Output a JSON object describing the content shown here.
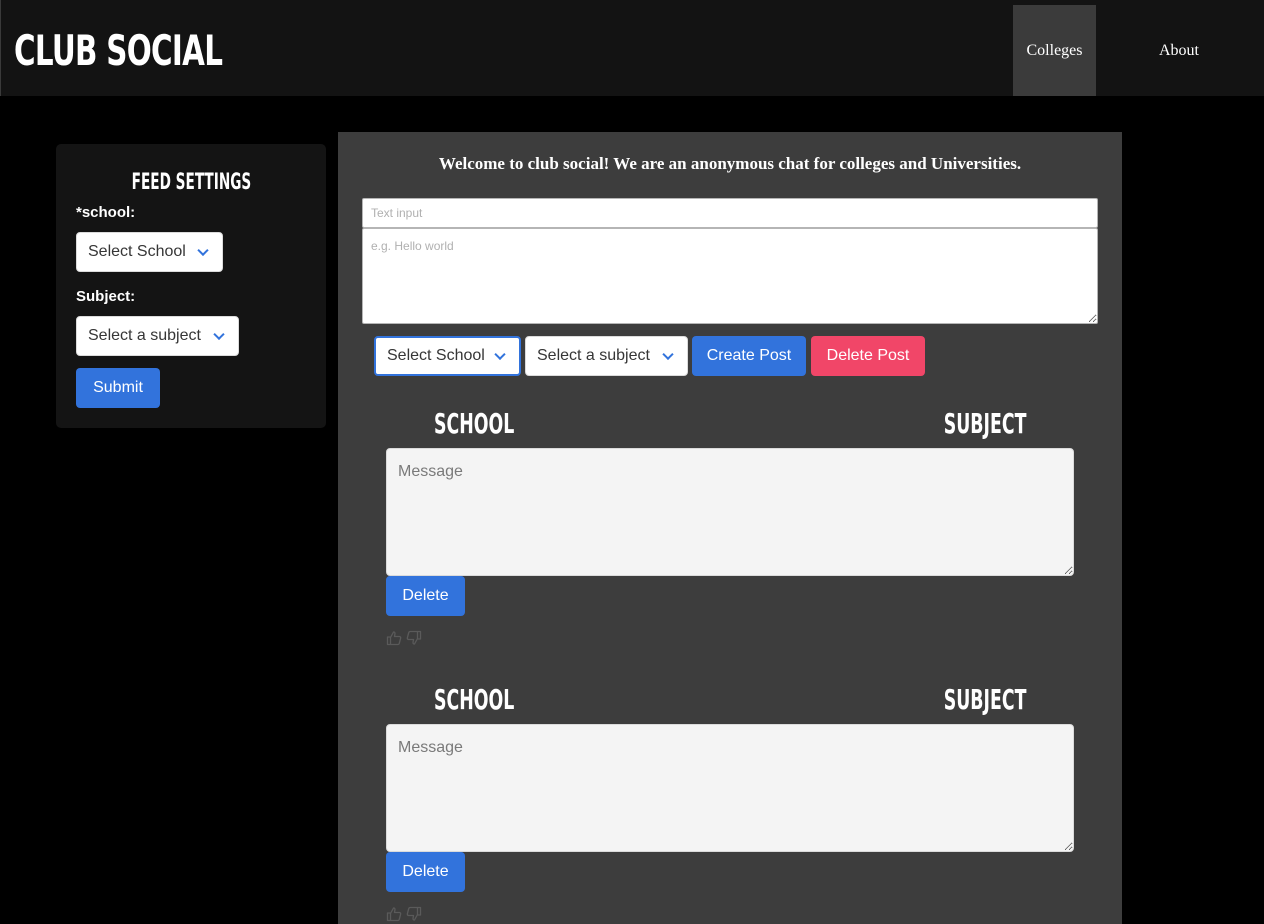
{
  "brand": "CLUB SOCIAL",
  "nav": {
    "colleges": "Colleges",
    "about": "About"
  },
  "sidebar": {
    "title": "FEED SETTINGS",
    "school_label": "*school:",
    "school_select": "Select School",
    "subject_label": "Subject:",
    "subject_select": "Select a subject",
    "submit": "Submit"
  },
  "main": {
    "welcome": "Welcome to club social! We are an anonymous chat for colleges and Universities.",
    "text_input_placeholder": "Text input",
    "textarea_placeholder": "e.g. Hello world",
    "school_select": "Select School",
    "subject_select": "Select a subject",
    "create_post": "Create Post",
    "delete_post": "Delete Post"
  },
  "posts": [
    {
      "school": "SCHOOL",
      "subject": "SUBJECT",
      "message_placeholder": "Message",
      "delete": "Delete"
    },
    {
      "school": "SCHOOL",
      "subject": "SUBJECT",
      "message_placeholder": "Message",
      "delete": "Delete"
    }
  ],
  "colors": {
    "accent": "#3273dc",
    "danger": "#f14668",
    "panel": "#3d3d3d",
    "header": "#131313"
  },
  "icons": {
    "vote_up": "thumbs-up-icon",
    "vote_down": "thumbs-down-icon",
    "select_arrow": "chevron-down-icon"
  }
}
